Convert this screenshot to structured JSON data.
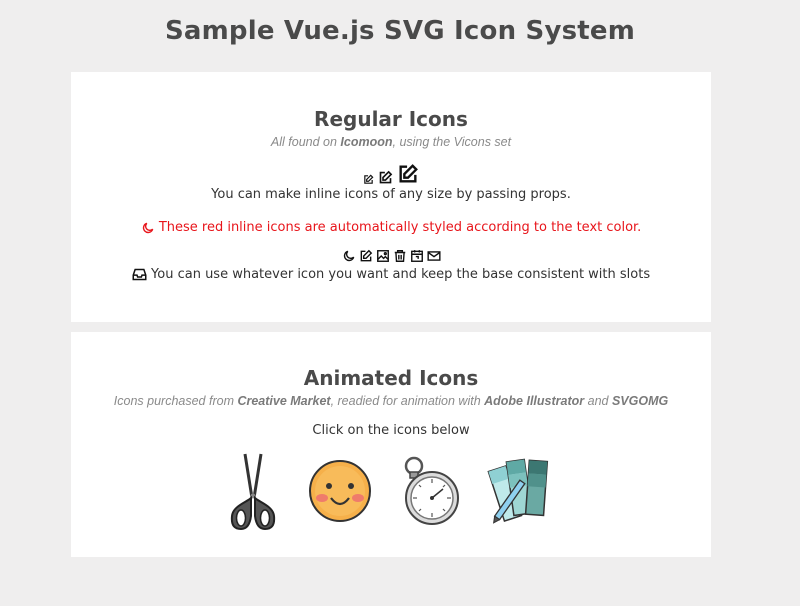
{
  "page": {
    "title": "Sample Vue.js SVG Icon System"
  },
  "regular": {
    "heading": "Regular Icons",
    "sub_prefix": "All found on ",
    "sub_source": "Icomoon",
    "sub_suffix": ", using the Vicons set",
    "size_text": "You can make inline icons of any size by passing props.",
    "red_text": "These red inline icons are automatically styled according to the text color.",
    "slot_text": "You can use whatever icon you want and keep the base consistent with slots",
    "icons": [
      "edit-icon",
      "moon-icon",
      "image-icon",
      "trash-icon",
      "calendar-icon",
      "mail-icon",
      "inbox-icon"
    ],
    "red_color": "#e8151b"
  },
  "animated": {
    "heading": "Animated Icons",
    "sub_prefix": "Icons purchased from ",
    "sub_source": "Creative Market",
    "sub_middle": ", readied for animation with ",
    "sub_tool1": "Adobe Illustrator",
    "sub_and": " and ",
    "sub_tool2": "SVGOMG",
    "instruction": "Click on the icons below",
    "icons": [
      "scissors-icon",
      "smiley-icon",
      "stopwatch-icon",
      "color-swatch-icon"
    ]
  }
}
